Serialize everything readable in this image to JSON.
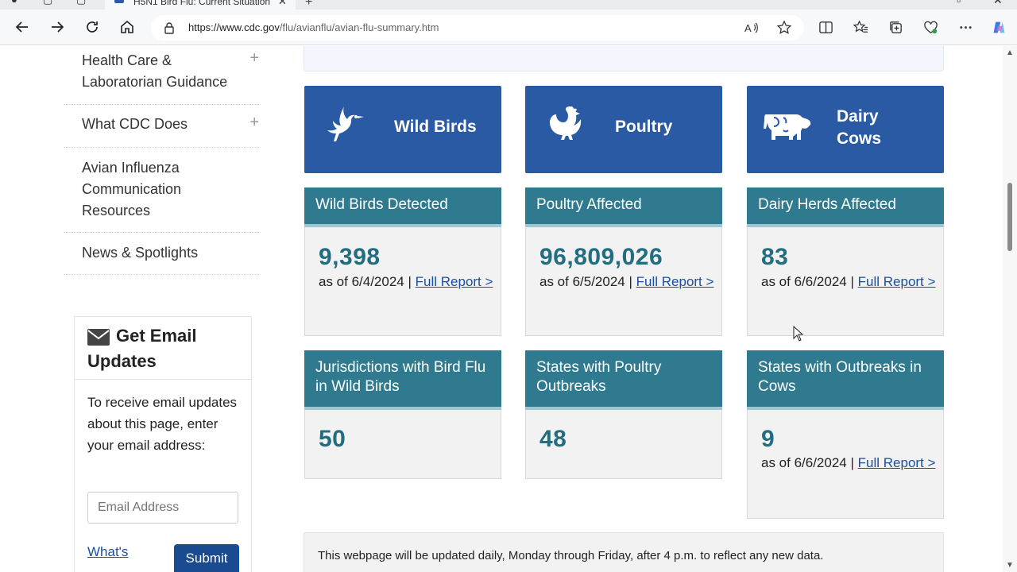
{
  "browser": {
    "tab_title": "H5N1 Bird Flu: Current Situation",
    "url_host": "https://www.cdc.gov",
    "url_path": "/flu/avianflu/avian-flu-summary.htm"
  },
  "sidebar": {
    "items": [
      {
        "label": "Health Care & Laboratorian Guidance",
        "expand": "+"
      },
      {
        "label": "What CDC Does",
        "expand": "+"
      },
      {
        "label": "Avian Influenza Communication Resources",
        "expand": ""
      },
      {
        "label": "News & Spotlights",
        "expand": ""
      }
    ]
  },
  "email_widget": {
    "title": "Get Email Updates",
    "description": "To receive email updates about this page, enter your email address:",
    "placeholder": "Email Address",
    "whats_this": "What's",
    "submit": "Submit"
  },
  "categories": [
    {
      "label": "Wild Birds",
      "icon": "bird-icon"
    },
    {
      "label": "Poultry",
      "icon": "chicken-icon"
    },
    {
      "label": "Dairy Cows",
      "icon": "cow-icon"
    }
  ],
  "stats": [
    {
      "title": "Wild Birds Detected",
      "value": "9,398",
      "as_of": "as of 6/4/2024 |",
      "link": "Full Report >"
    },
    {
      "title": "Poultry Affected",
      "value": "96,809,026",
      "as_of": "as of 6/5/2024 |",
      "link": "Full Report >"
    },
    {
      "title": "Dairy Herds Affected",
      "value": "83",
      "as_of": "as of 6/6/2024 |",
      "link": "Full Report >"
    },
    {
      "title": "Jurisdictions with Bird Flu in Wild Birds",
      "value": "50"
    },
    {
      "title": "States with Poultry Outbreaks",
      "value": "48"
    },
    {
      "title": "States with Outbreaks in Cows",
      "value": "9",
      "as_of": "as of 6/6/2024 |",
      "link": "Full Report >"
    }
  ],
  "footer_note": "This webpage will be updated daily, Monday through Friday, after 4 p.m. to reflect any new data.",
  "colors": {
    "category_blue": "#2b5aa5",
    "stat_teal": "#2f7a8e",
    "stat_number": "#236d80",
    "link_blue": "#1a4fa3"
  }
}
